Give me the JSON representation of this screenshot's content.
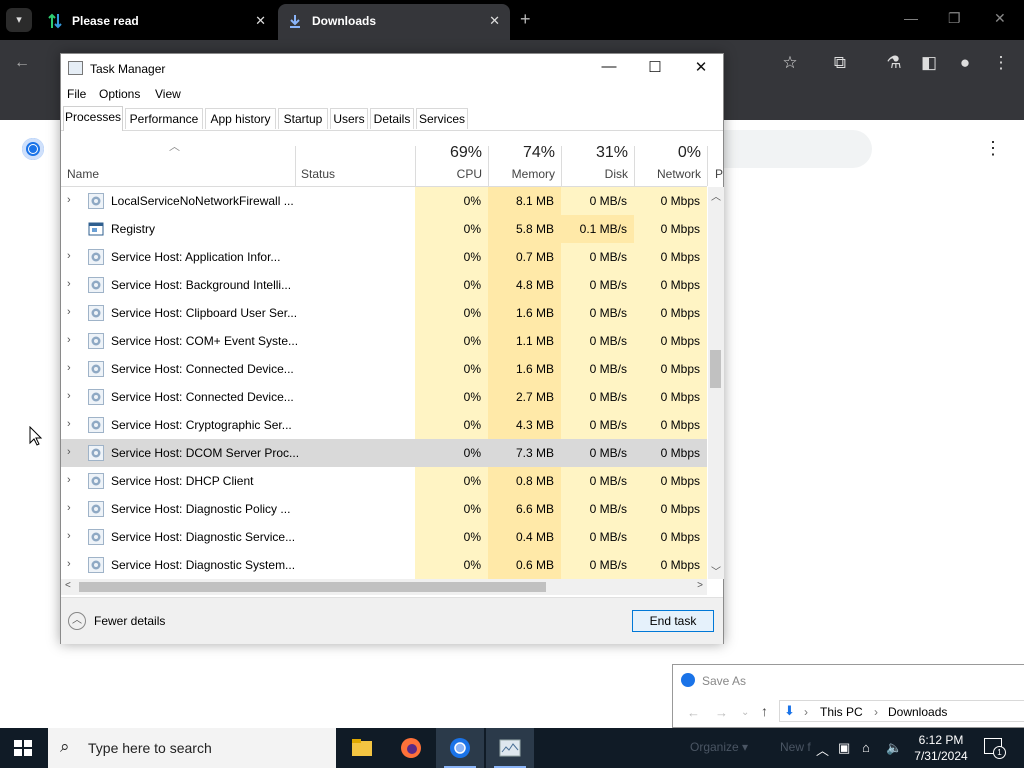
{
  "browser": {
    "tabs": [
      {
        "label": "Please read",
        "close": "✕"
      },
      {
        "label": "Downloads",
        "close": "✕"
      }
    ],
    "new_tab": "+"
  },
  "task_manager": {
    "title": "Task Manager",
    "menu": [
      "File",
      "Options",
      "View"
    ],
    "tabs": [
      "Processes",
      "Performance",
      "App history",
      "Startup",
      "Users",
      "Details",
      "Services"
    ],
    "columns": {
      "name": "Name",
      "status": "Status",
      "cpu": {
        "pct": "69%",
        "label": "CPU"
      },
      "memory": {
        "pct": "74%",
        "label": "Memory"
      },
      "disk": {
        "pct": "31%",
        "label": "Disk"
      },
      "network": {
        "pct": "0%",
        "label": "Network"
      },
      "power": "P"
    },
    "rows": [
      {
        "name": "LocalServiceNoNetworkFirewall ...",
        "cpu": "0%",
        "mem": "8.1 MB",
        "disk": "0 MB/s",
        "net": "0 Mbps",
        "expand": true,
        "icon": "gear-icon"
      },
      {
        "name": "Registry",
        "cpu": "0%",
        "mem": "5.8 MB",
        "disk": "0.1 MB/s",
        "net": "0 Mbps",
        "expand": false,
        "icon": "window-icon"
      },
      {
        "name": "Service Host: Application Infor...",
        "cpu": "0%",
        "mem": "0.7 MB",
        "disk": "0 MB/s",
        "net": "0 Mbps",
        "expand": true,
        "icon": "gear-icon"
      },
      {
        "name": "Service Host: Background Intelli...",
        "cpu": "0%",
        "mem": "4.8 MB",
        "disk": "0 MB/s",
        "net": "0 Mbps",
        "expand": true,
        "icon": "gear-icon"
      },
      {
        "name": "Service Host: Clipboard User Ser...",
        "cpu": "0%",
        "mem": "1.6 MB",
        "disk": "0 MB/s",
        "net": "0 Mbps",
        "expand": true,
        "icon": "gear-icon"
      },
      {
        "name": "Service Host: COM+ Event Syste...",
        "cpu": "0%",
        "mem": "1.1 MB",
        "disk": "0 MB/s",
        "net": "0 Mbps",
        "expand": true,
        "icon": "gear-icon"
      },
      {
        "name": "Service Host: Connected Device...",
        "cpu": "0%",
        "mem": "1.6 MB",
        "disk": "0 MB/s",
        "net": "0 Mbps",
        "expand": true,
        "icon": "gear-icon"
      },
      {
        "name": "Service Host: Connected Device...",
        "cpu": "0%",
        "mem": "2.7 MB",
        "disk": "0 MB/s",
        "net": "0 Mbps",
        "expand": true,
        "icon": "gear-icon"
      },
      {
        "name": "Service Host: Cryptographic Ser...",
        "cpu": "0%",
        "mem": "4.3 MB",
        "disk": "0 MB/s",
        "net": "0 Mbps",
        "expand": true,
        "icon": "gear-icon"
      },
      {
        "name": "Service Host: DCOM Server Proc...",
        "cpu": "0%",
        "mem": "7.3 MB",
        "disk": "0 MB/s",
        "net": "0 Mbps",
        "expand": true,
        "icon": "gear-icon",
        "selected": true
      },
      {
        "name": "Service Host: DHCP Client",
        "cpu": "0%",
        "mem": "0.8 MB",
        "disk": "0 MB/s",
        "net": "0 Mbps",
        "expand": true,
        "icon": "gear-icon"
      },
      {
        "name": "Service Host: Diagnostic Policy ...",
        "cpu": "0%",
        "mem": "6.6 MB",
        "disk": "0 MB/s",
        "net": "0 Mbps",
        "expand": true,
        "icon": "gear-icon"
      },
      {
        "name": "Service Host: Diagnostic Service...",
        "cpu": "0%",
        "mem": "0.4 MB",
        "disk": "0 MB/s",
        "net": "0 Mbps",
        "expand": true,
        "icon": "gear-icon"
      },
      {
        "name": "Service Host: Diagnostic System...",
        "cpu": "0%",
        "mem": "0.6 MB",
        "disk": "0 MB/s",
        "net": "0 Mbps",
        "expand": true,
        "icon": "gear-icon"
      }
    ],
    "fewer_details": "Fewer details",
    "end_task": "End task"
  },
  "save_as": {
    "title": "Save As",
    "path": [
      "This PC",
      "Downloads"
    ],
    "toolbar": [
      "Organize ▾",
      "New f"
    ]
  },
  "taskbar": {
    "search_placeholder": "Type here to search",
    "time": "6:12 PM",
    "date": "7/31/2024",
    "notification_count": "1"
  }
}
